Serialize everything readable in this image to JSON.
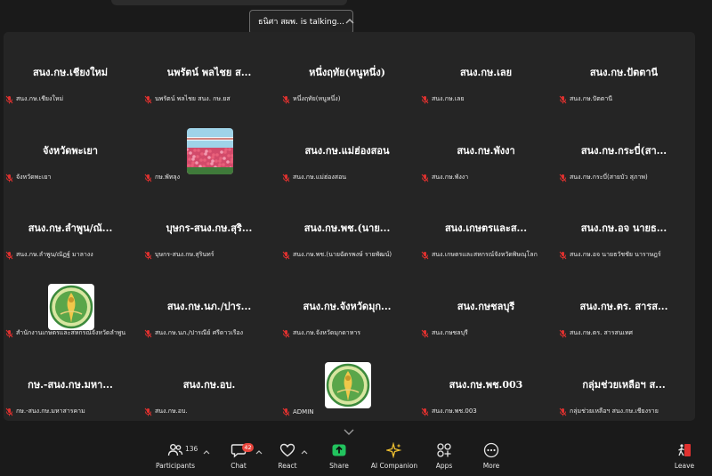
{
  "talking_indicator": "ธนิศา สผพ. is talking...",
  "tiles": [
    {
      "title": "สนง.กษ.เชียงใหม่",
      "name": "สนง.กษ.เชียงใหม่"
    },
    {
      "title": "นพรัตน์ พลไชย ส...",
      "name": "นพรัตน์ พลไชย สนง. กษ.ยส"
    },
    {
      "title": "หนึ่งฤทัย(หนูหนึ่ง)",
      "name": "หนึ่งฤทัย(หนูหนึ่ง)"
    },
    {
      "title": "สนง.กษ.เลย",
      "name": "สนง.กษ.เลย"
    },
    {
      "title": "สนง.กษ.ปัตตานี",
      "name": "สนง.กษ.ปัตตานี"
    },
    {
      "title": "จังหวัดพะเยา",
      "name": "จังหวัดพะเยา"
    },
    {
      "title": "",
      "name": "กษ.พัทลุง",
      "avatar": "flower-field"
    },
    {
      "title": "สนง.กษ.แม่ฮ่องสอน",
      "name": "สนง.กษ.แม่ฮ่องสอน"
    },
    {
      "title": "สนง.กษ.พังงา",
      "name": "สนง.กษ.พังงา"
    },
    {
      "title": "สนง.กษ.กระบี่(สา...",
      "name": "สนง.กษ.กระบี่(สายบัว สุภาพ)"
    },
    {
      "title": "สนง.กษ.ลำพูน/ณั...",
      "name": "สนง.กษ.ลำพูน/ณัฏฐ์ มาลางง"
    },
    {
      "title": "บุษกร-สนง.กษ.สุริ...",
      "name": "บุษกร-สนง.กษ.สุรินทร์"
    },
    {
      "title": "สนง.กษ.พช.(นาย...",
      "name": "สนง.กษ.พช.(นายฉัตรพงษ์ รายพัฒน์)"
    },
    {
      "title": "สนง.เกษตรและส...",
      "name": "สนง.เกษตรและสหกรณ์จังหวัดพิษณุโลก"
    },
    {
      "title": "สนง.กษ.อจ นายธ...",
      "name": "สนง.กษ.อจ นายธวัชชัย นาราษฎร์"
    },
    {
      "title": "",
      "name": "สำนักงานเกษตรและสหกรณ์จังหวัดลำพูน",
      "avatar": "ministry-seal"
    },
    {
      "title": "สนง.กษ.นภ./ปาร...",
      "name": "สนง.กษ.นภ./ปารณีย์ ศรีดาวเรือง"
    },
    {
      "title": "สนง.กษ.จังหวัดมุก...",
      "name": "สนง.กษ.จังหวัดมุกดาหาร"
    },
    {
      "title": "สนง.กษชลบุรี",
      "name": "สนง.กษชลบุรี"
    },
    {
      "title": "สนง.กษ.ตร. สารส...",
      "name": "สนง.กษ.ตร. สารสนเทศ"
    },
    {
      "title": "กษ.-สนง.กษ.มหา...",
      "name": "กษ.-สนง.กษ.มหาสารคาม"
    },
    {
      "title": "สนง.กษ.อบ.",
      "name": "สนง.กษ.อบ."
    },
    {
      "title": "",
      "name": "ADMIN",
      "avatar": "ministry-seal"
    },
    {
      "title": "สนง.กษ.พช.003",
      "name": "สนง.กษ.พช.003"
    },
    {
      "title": "กลุ่มช่วยเหลือฯ ส...",
      "name": "กลุ่มช่วยเหลือฯ สนง.กษ.เชียงราย"
    }
  ],
  "toolbar": {
    "participants_label": "Participants",
    "participants_count": "136",
    "chat_label": "Chat",
    "chat_badge": "42",
    "react_label": "React",
    "share_label": "Share",
    "ai_label": "AI Companion",
    "apps_label": "Apps",
    "more_label": "More",
    "leave_label": "Leave"
  },
  "colors": {
    "background": "#1a1a1a",
    "gallery": "#252525",
    "share_green": "#22c35e",
    "mic_off_red": "#e0312f",
    "ai_gold": "#f0c030",
    "badge_red": "#e8453c"
  }
}
